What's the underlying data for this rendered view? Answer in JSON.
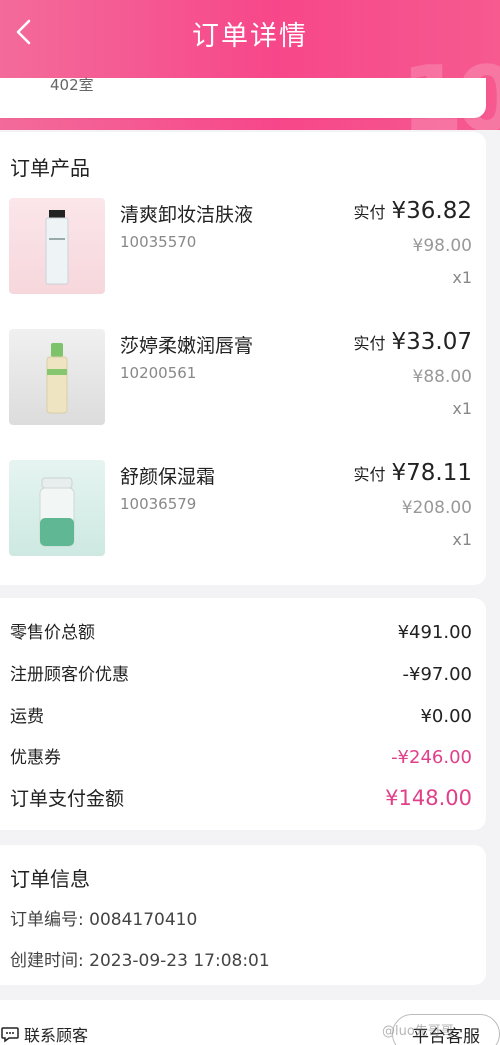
{
  "header": {
    "title": "订单详情",
    "deco": "10"
  },
  "prev_card": {
    "text": "402室"
  },
  "products": {
    "title": "订单产品",
    "items": [
      {
        "name": "清爽卸妆洁肤液",
        "code": "10035570",
        "paid_label": "实付",
        "paid": "¥36.82",
        "original": "¥98.00",
        "qty": "x1"
      },
      {
        "name": "莎婷柔嫩润唇膏",
        "code": "10200561",
        "paid_label": "实付",
        "paid": "¥33.07",
        "original": "¥88.00",
        "qty": "x1"
      },
      {
        "name": "舒颜保湿霜",
        "code": "10036579",
        "paid_label": "实付",
        "paid": "¥78.11",
        "original": "¥208.00",
        "qty": "x1"
      }
    ]
  },
  "summary": {
    "retail_label": "零售价总额",
    "retail_value": "¥491.00",
    "member_label": "注册顾客价优惠",
    "member_value": "-¥97.00",
    "shipping_label": "运费",
    "shipping_value": "¥0.00",
    "coupon_label": "优惠券",
    "coupon_value": "-¥246.00",
    "total_label": "订单支付金额",
    "total_value": "¥148.00"
  },
  "order_info": {
    "title": "订单信息",
    "number_label": "订单编号:",
    "number_value": "0084170410",
    "created_label": "创建时间:",
    "created_value": "2023-09-23 17:08:01"
  },
  "bottom": {
    "contact_label": "联系顾客",
    "service_label": "平台客服"
  },
  "watermark": "@luo先哥哥",
  "colors": {
    "accent": "#f7478a",
    "price_pink": "#e0408a"
  }
}
